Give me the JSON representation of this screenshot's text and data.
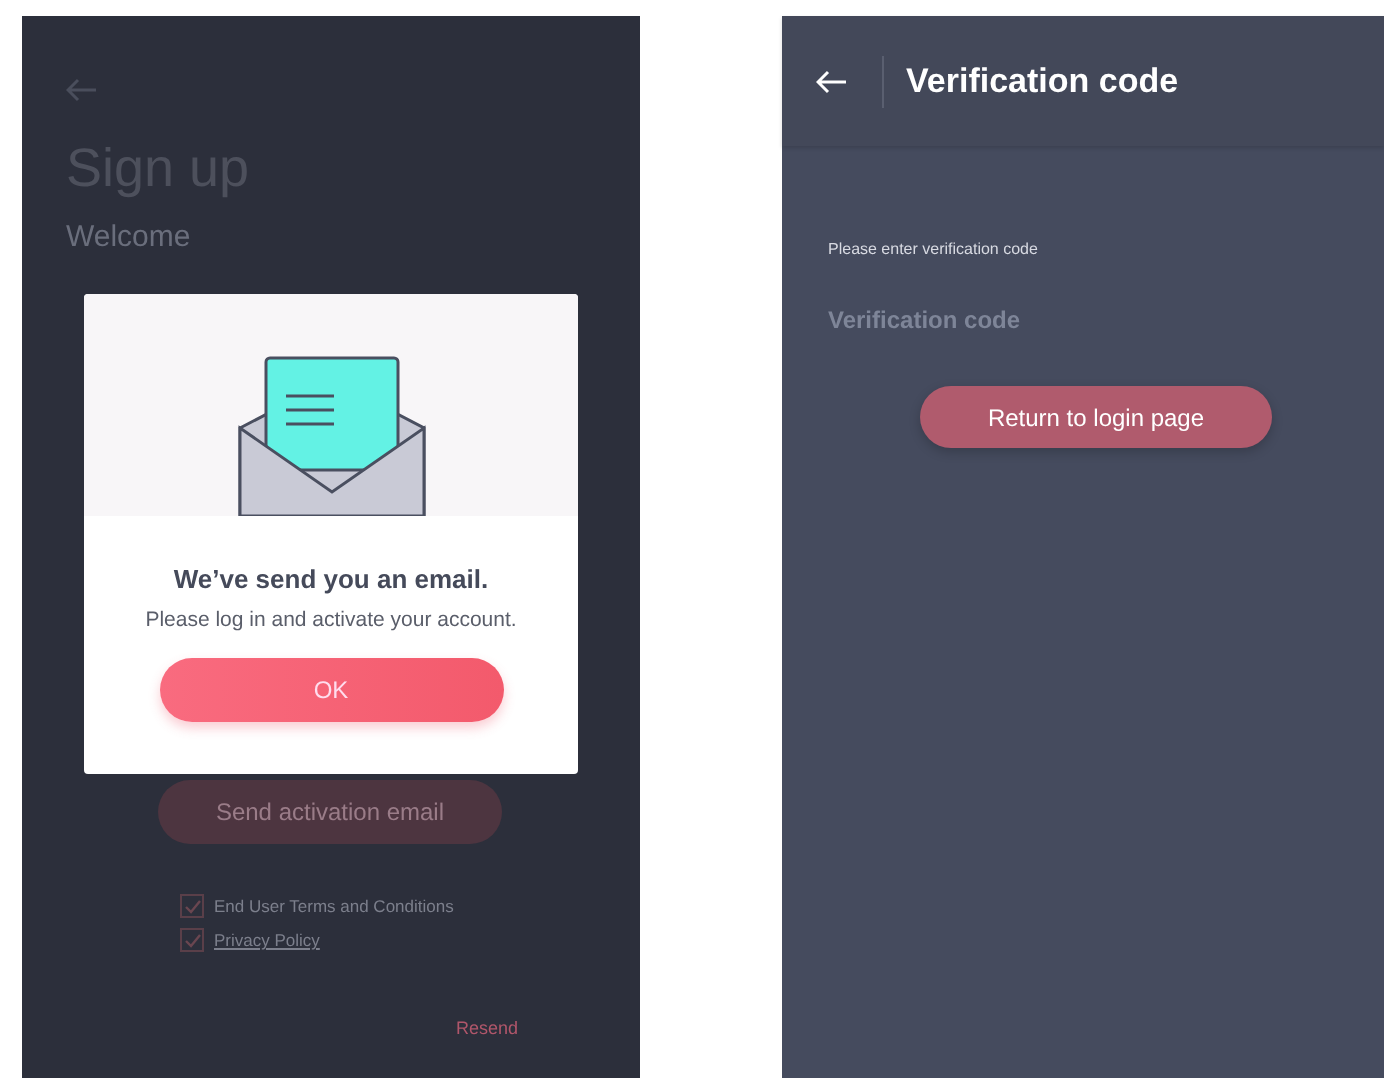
{
  "signup": {
    "title": "Sign up",
    "subtitle": "Welcome",
    "send_button": "Send activation email",
    "agreements": [
      {
        "label": "End User Terms and Conditions",
        "checked": true,
        "link": false
      },
      {
        "label": "Privacy Policy",
        "checked": true,
        "link": true
      }
    ],
    "resend_link": "Resend"
  },
  "dialog": {
    "title": "We’ve send you an email.",
    "message": "Please log in and activate your account.",
    "ok_button": "OK"
  },
  "verification": {
    "title": "Verification code",
    "prompt": "Please enter verification code",
    "field": {
      "placeholder": "Verification code"
    },
    "return_button": "Return to login page"
  }
}
